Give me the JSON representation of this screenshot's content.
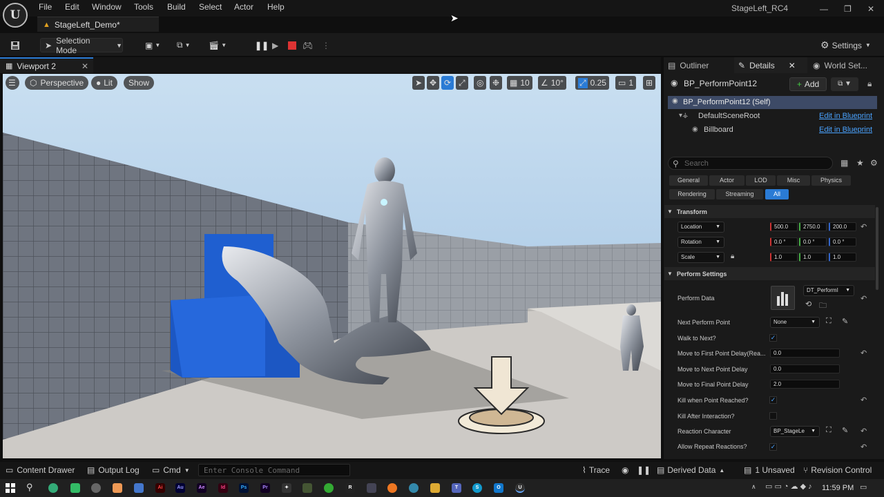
{
  "menubar": {
    "items": [
      "File",
      "Edit",
      "Window",
      "Tools",
      "Build",
      "Select",
      "Actor",
      "Help"
    ],
    "project": "StageLeft_RC4"
  },
  "doc_tab": {
    "label": "StageLeft_Demo*"
  },
  "toolbar": {
    "selection_mode": "Selection Mode",
    "settings": "Settings"
  },
  "viewport": {
    "tab": "Viewport 2",
    "perspective": "Perspective",
    "lit": "Lit",
    "show": "Show",
    "grid": "10",
    "angle": "10°",
    "scale": "0.25",
    "cam": "1"
  },
  "panel_tabs": {
    "outliner": "Outliner",
    "details": "Details",
    "world": "World Set..."
  },
  "details": {
    "actor": "BP_PerformPoint12",
    "add": "Add",
    "tree": [
      {
        "label": "BP_PerformPoint12 (Self)"
      },
      {
        "label": "DefaultSceneRoot",
        "link": "Edit in Blueprint"
      },
      {
        "label": "Billboard",
        "link": "Edit in Blueprint"
      }
    ],
    "search_placeholder": "Search",
    "cats_row1": [
      "General",
      "Actor",
      "LOD",
      "Misc",
      "Physics"
    ],
    "cats_row2": [
      "Rendering",
      "Streaming",
      "All"
    ],
    "transform": {
      "title": "Transform",
      "location_label": "Location",
      "rotation_label": "Rotation",
      "scale_label": "Scale",
      "location": [
        "500.0",
        "2750.0",
        "200.0"
      ],
      "rotation": [
        "0.0 °",
        "0.0 °",
        "0.0 °"
      ],
      "scale": [
        "1.0",
        "1.0",
        "1.0"
      ]
    },
    "perform": {
      "title": "Perform Settings",
      "perform_data": "Perform Data",
      "perform_data_value": "DT_PerformI",
      "next_point": "Next Perform Point",
      "next_point_value": "None",
      "walk_next": "Walk to Next?",
      "first_delay": "Move to First Point Delay(Rea...",
      "first_delay_value": "0.0",
      "next_delay": "Move to Next Point Delay",
      "next_delay_value": "0.0",
      "final_delay": "Move to Final Point Delay",
      "final_delay_value": "2.0",
      "kill_reached": "Kill when Point Reached?",
      "kill_after": "Kill After Interaction?",
      "reaction": "Reaction Character",
      "reaction_value": "BP_StageLe",
      "allow_repeat": "Allow Repeat Reactions?"
    }
  },
  "statusbar": {
    "content_drawer": "Content Drawer",
    "output_log": "Output Log",
    "cmd": "Cmd",
    "console_placeholder": "Enter Console Command",
    "trace": "Trace",
    "derived": "Derived Data",
    "unsaved": "1 Unsaved",
    "revision": "Revision Control"
  },
  "taskbar": {
    "time": "11:59 PM"
  },
  "colors": {
    "accent": "#2a7bd5",
    "link": "#4aa3ff",
    "bg": "#1a1a1a"
  }
}
